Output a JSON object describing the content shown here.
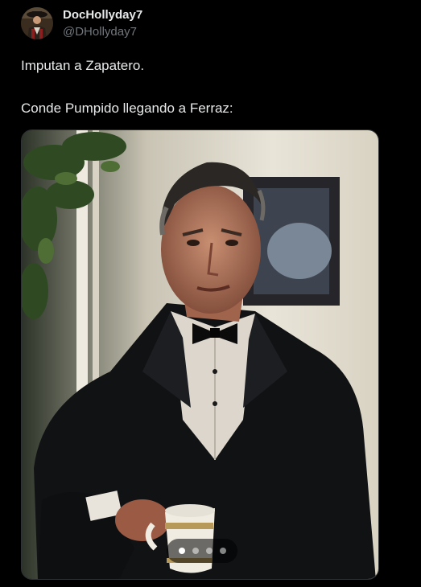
{
  "author": {
    "display_name": "DocHollyday7",
    "handle": "@DHollyday7",
    "avatar_icon": "user-avatar"
  },
  "tweet": {
    "line1": "Imputan a Zapatero.",
    "line2": "Conde Pumpido llegando a Ferraz:"
  },
  "media": {
    "image_icon": "photo",
    "pages": 4,
    "current_page": 1
  },
  "colors": {
    "background": "#000000",
    "text": "#e7e9ea",
    "muted": "#71767b"
  }
}
